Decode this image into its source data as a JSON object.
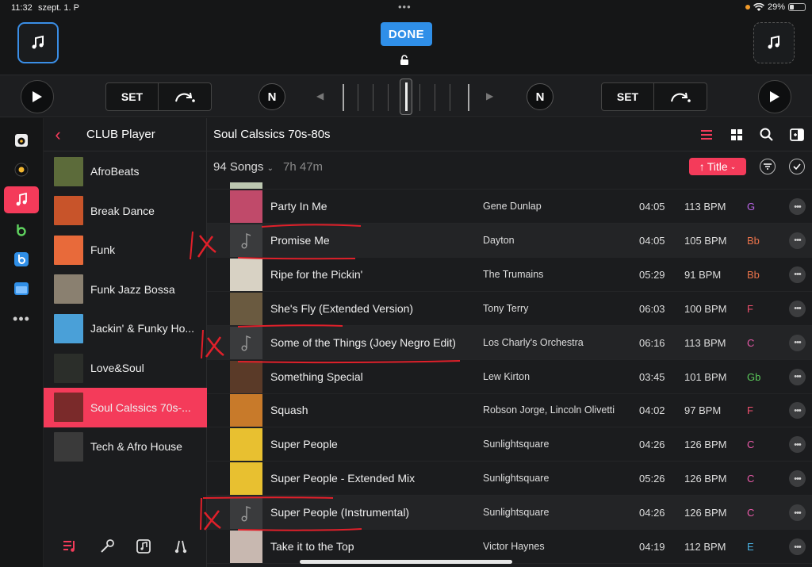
{
  "status": {
    "time": "11:32",
    "date": "szept. 1. P",
    "battery": "29%"
  },
  "header": {
    "done_label": "DONE"
  },
  "transport": {
    "set_left": "SET",
    "set_right": "SET",
    "n_left": "N",
    "n_right": "N"
  },
  "sidebar": {
    "title": "CLUB Player",
    "items": [
      {
        "label": "AfroBeats",
        "color": "#5c6b3a"
      },
      {
        "label": "Break Dance",
        "color": "#c8542a"
      },
      {
        "label": "Funk",
        "color": "#e86a3a"
      },
      {
        "label": "Funk Jazz Bossa",
        "color": "#8a8070"
      },
      {
        "label": "Jackin' & Funky Ho...",
        "color": "#4aa0d8"
      },
      {
        "label": "Love&Soul",
        "color": "#2b2e2a"
      },
      {
        "label": "Soul Calssics 70s-...",
        "color": "#7a2a2a"
      },
      {
        "label": "Tech & Afro House",
        "color": "#3a3a3a"
      }
    ]
  },
  "main": {
    "title": "Soul Calssics 70s-80s",
    "song_count": "94 Songs",
    "total_duration": "7h 47m",
    "sort_label": "Title"
  },
  "songs": [
    {
      "title": "Party In Me",
      "artist": "Gene Dunlap",
      "time": "04:05",
      "bpm": "113 BPM",
      "key": "G",
      "key_color": "#b964e6",
      "art": "#c04a6a",
      "placeholder": false,
      "dim": false
    },
    {
      "title": "Promise Me",
      "artist": "Dayton",
      "time": "04:05",
      "bpm": "105 BPM",
      "key": "Bb",
      "key_color": "#e8724a",
      "art": "",
      "placeholder": true,
      "dim": true
    },
    {
      "title": "Ripe for the Pickin'",
      "artist": "The Trumains",
      "time": "05:29",
      "bpm": "91 BPM",
      "key": "Bb",
      "key_color": "#e8724a",
      "art": "#d8d2c4",
      "placeholder": false,
      "dim": false
    },
    {
      "title": "She's Fly (Extended Version)",
      "artist": "Tony Terry",
      "time": "06:03",
      "bpm": "100 BPM",
      "key": "F",
      "key_color": "#f0506e",
      "art": "#6a5a40",
      "placeholder": false,
      "dim": false
    },
    {
      "title": "Some of the Things (Joey Negro Edit)",
      "artist": "Los Charly's Orchestra",
      "time": "06:16",
      "bpm": "113 BPM",
      "key": "C",
      "key_color": "#e85aa8",
      "art": "",
      "placeholder": true,
      "dim": true
    },
    {
      "title": "Something Special",
      "artist": "Lew Kirton",
      "time": "03:45",
      "bpm": "101 BPM",
      "key": "Gb",
      "key_color": "#5ac85a",
      "art": "#5a3a28",
      "placeholder": false,
      "dim": false
    },
    {
      "title": "Squash",
      "artist": "Robson Jorge, Lincoln Olivetti",
      "time": "04:02",
      "bpm": "97 BPM",
      "key": "F",
      "key_color": "#f0506e",
      "art": "#c87a2a",
      "placeholder": false,
      "dim": false
    },
    {
      "title": "Super People",
      "artist": "Sunlightsquare",
      "time": "04:26",
      "bpm": "126 BPM",
      "key": "C",
      "key_color": "#e85aa8",
      "art": "#e8c030",
      "placeholder": false,
      "dim": false
    },
    {
      "title": "Super People - Extended Mix",
      "artist": "Sunlightsquare",
      "time": "05:26",
      "bpm": "126 BPM",
      "key": "C",
      "key_color": "#e85aa8",
      "art": "#e8c030",
      "placeholder": false,
      "dim": false
    },
    {
      "title": "Super People (Instrumental)",
      "artist": "Sunlightsquare",
      "time": "04:26",
      "bpm": "126 BPM",
      "key": "C",
      "key_color": "#e85aa8",
      "art": "",
      "placeholder": true,
      "dim": true
    },
    {
      "title": "Take it to the Top",
      "artist": "Victor Haynes",
      "time": "04:19",
      "bpm": "112 BPM",
      "key": "E",
      "key_color": "#4ab0e0",
      "art": "#c8b8b0",
      "placeholder": false,
      "dim": false
    }
  ]
}
